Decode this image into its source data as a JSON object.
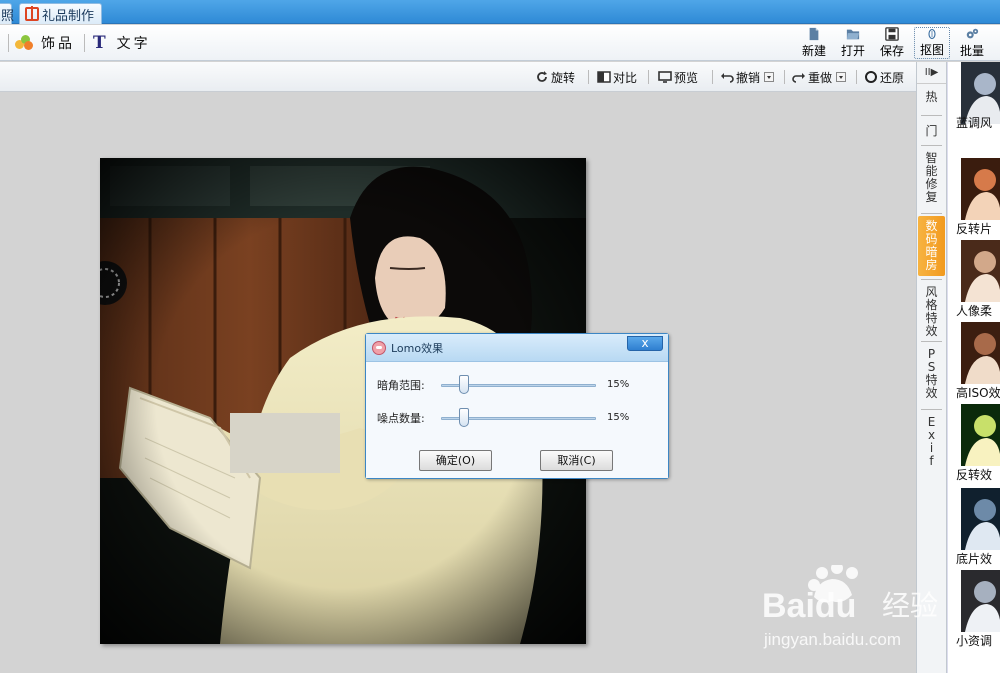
{
  "tabs": {
    "prev_label": "照",
    "active_label": "礼品制作"
  },
  "toolbar": {
    "decor_label": "饰品",
    "text_label": "文字",
    "new_label": "新建",
    "open_label": "打开",
    "save_label": "保存",
    "cutout_label": "抠图",
    "batch_label": "批量"
  },
  "subbar": {
    "rotate": "旋转",
    "compare": "对比",
    "preview": "预览",
    "undo": "撤销",
    "redo": "重做",
    "restore": "还原"
  },
  "dialog": {
    "title": "Lomo效果",
    "close_glyph": "x",
    "sliders": [
      {
        "label": "暗角范围:",
        "value": "15%",
        "fraction": 0.15
      },
      {
        "label": "噪点数量:",
        "value": "15%",
        "fraction": 0.15
      }
    ],
    "ok_label": "确定(O)",
    "cancel_label": "取消(C)"
  },
  "side_tabs": {
    "collapse_glyph": "II▶",
    "items": [
      "热",
      "门",
      "智能修复",
      "数码暗房",
      "风格特效",
      "PS特效",
      "Exif"
    ],
    "active": "数码暗房"
  },
  "thumbnails": [
    "蓝调风",
    "反转片",
    "人像柔",
    "高ISO效",
    "反转效",
    "底片效",
    "小资调"
  ],
  "watermark": {
    "brand": "Baidu",
    "cn": "经验",
    "url": "jingyan.baidu.com"
  },
  "colors": {
    "accent": "#2f8ad6",
    "active_tab": "#f29a1f"
  }
}
